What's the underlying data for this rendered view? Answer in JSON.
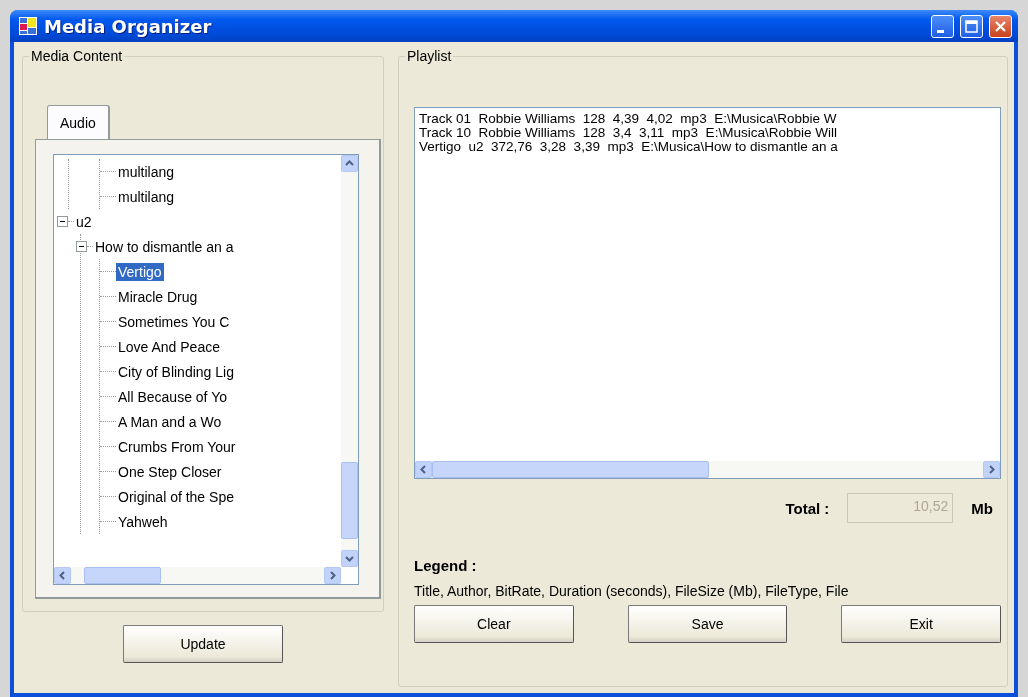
{
  "window": {
    "title": "Media Organizer"
  },
  "media_content": {
    "title": "Media Content",
    "tabs": [
      {
        "label": "Audio",
        "selected": true
      }
    ],
    "tree": {
      "items": [
        {
          "children": [
            {
              "children": [
                {
                  "label": "multilang",
                  "selected": false
                },
                {
                  "label": "multilang",
                  "selected": false
                }
              ]
            }
          ]
        },
        {
          "label": "u2",
          "expanded": true,
          "selected": false,
          "children": [
            {
              "label": "How to dismantle an a",
              "expanded": true,
              "selected": false,
              "children": [
                {
                  "label": "Vertigo",
                  "selected": true
                },
                {
                  "label": "Miracle Drug",
                  "selected": false
                },
                {
                  "label": "Sometimes You C",
                  "selected": false
                },
                {
                  "label": "Love And Peace",
                  "selected": false
                },
                {
                  "label": "City of Blinding Lig",
                  "selected": false
                },
                {
                  "label": "All Because of Yo",
                  "selected": false
                },
                {
                  "label": "A Man and a Wo",
                  "selected": false
                },
                {
                  "label": "Crumbs From Your",
                  "selected": false
                },
                {
                  "label": "One Step Closer",
                  "selected": false
                },
                {
                  "label": "Original of the Spe",
                  "selected": false
                },
                {
                  "label": "Yahweh",
                  "selected": false
                }
              ]
            }
          ]
        }
      ]
    },
    "update_button": "Update"
  },
  "playlist": {
    "title": "Playlist",
    "items": [
      "Track 01  Robbie Williams  128  4,39  4,02  mp3  E:\\Musica\\Robbie W",
      "Track 10  Robbie Williams  128  3,4  3,11  mp3  E:\\Musica\\Robbie Will",
      "Vertigo  u2  372,76  3,28  3,39  mp3  E:\\Musica\\How to dismantle an a"
    ],
    "total": {
      "label": "Total :",
      "value": "10,52",
      "disabled": true,
      "unit": "Mb"
    },
    "legend": {
      "label": "Legend :",
      "text": "Title, Author, BitRate, Duration (seconds), FileSize (Mb), FileType, File"
    },
    "buttons": [
      "Clear",
      "Save",
      "Exit"
    ]
  }
}
